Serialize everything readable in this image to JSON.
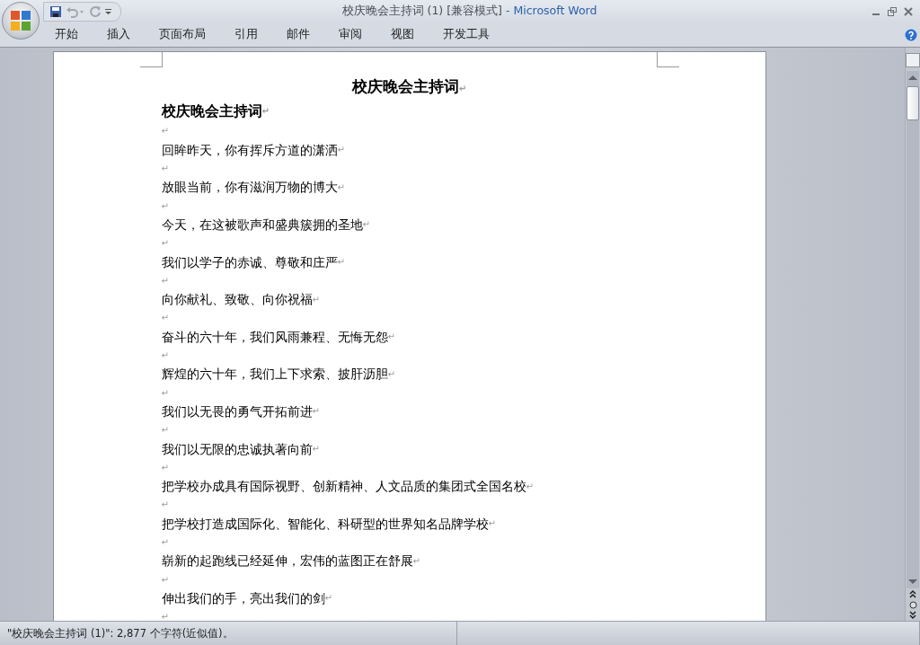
{
  "window": {
    "title": "校庆晚会主持词 (1) [兼容模式]",
    "app_name": "- Microsoft Word"
  },
  "tabs": [
    {
      "label": "开始",
      "selected": false
    },
    {
      "label": "插入",
      "selected": false
    },
    {
      "label": "页面布局",
      "selected": false
    },
    {
      "label": "引用",
      "selected": false
    },
    {
      "label": "邮件",
      "selected": false
    },
    {
      "label": "审阅",
      "selected": false
    },
    {
      "label": "视图",
      "selected": false
    },
    {
      "label": "开发工具",
      "selected": false
    }
  ],
  "document": {
    "paragraph_mark": "↵",
    "title": "校庆晚会主持词",
    "paragraphs": [
      {
        "kind": "heading",
        "text": "校庆晚会主持词"
      },
      {
        "kind": "empty"
      },
      {
        "kind": "text",
        "text": "回眸昨天，你有挥斥方道的潇洒"
      },
      {
        "kind": "empty"
      },
      {
        "kind": "text",
        "text": "放眼当前，你有滋润万物的博大"
      },
      {
        "kind": "empty"
      },
      {
        "kind": "text",
        "text": "今天，在这被歌声和盛典簇拥的圣地"
      },
      {
        "kind": "empty"
      },
      {
        "kind": "text",
        "text": "我们以学子的赤诚、尊敬和庄严"
      },
      {
        "kind": "empty"
      },
      {
        "kind": "text",
        "text": "向你献礼、致敬、向你祝福"
      },
      {
        "kind": "empty"
      },
      {
        "kind": "text",
        "text": "奋斗的六十年，我们风雨兼程、无悔无怨"
      },
      {
        "kind": "empty"
      },
      {
        "kind": "text",
        "text": "辉煌的六十年，我们上下求索、披肝沥胆"
      },
      {
        "kind": "empty"
      },
      {
        "kind": "text",
        "text": "我们以无畏的勇气开拓前进"
      },
      {
        "kind": "empty"
      },
      {
        "kind": "text",
        "text": "我们以无限的忠诚执著向前"
      },
      {
        "kind": "empty"
      },
      {
        "kind": "text",
        "text": "把学校办成具有国际视野、创新精神、人文品质的集团式全国名校"
      },
      {
        "kind": "empty"
      },
      {
        "kind": "text",
        "text": "把学校打造成国际化、智能化、科研型的世界知名品牌学校"
      },
      {
        "kind": "empty"
      },
      {
        "kind": "text",
        "text": "崭新的起跑线已经延伸，宏伟的蓝图正在舒展"
      },
      {
        "kind": "empty"
      },
      {
        "kind": "text",
        "text": "伸出我们的手，亮出我们的剑"
      },
      {
        "kind": "empty"
      }
    ]
  },
  "status_bar": {
    "text": "\"校庆晚会主持词 (1)\": 2,877 个字符(近似值)。"
  }
}
